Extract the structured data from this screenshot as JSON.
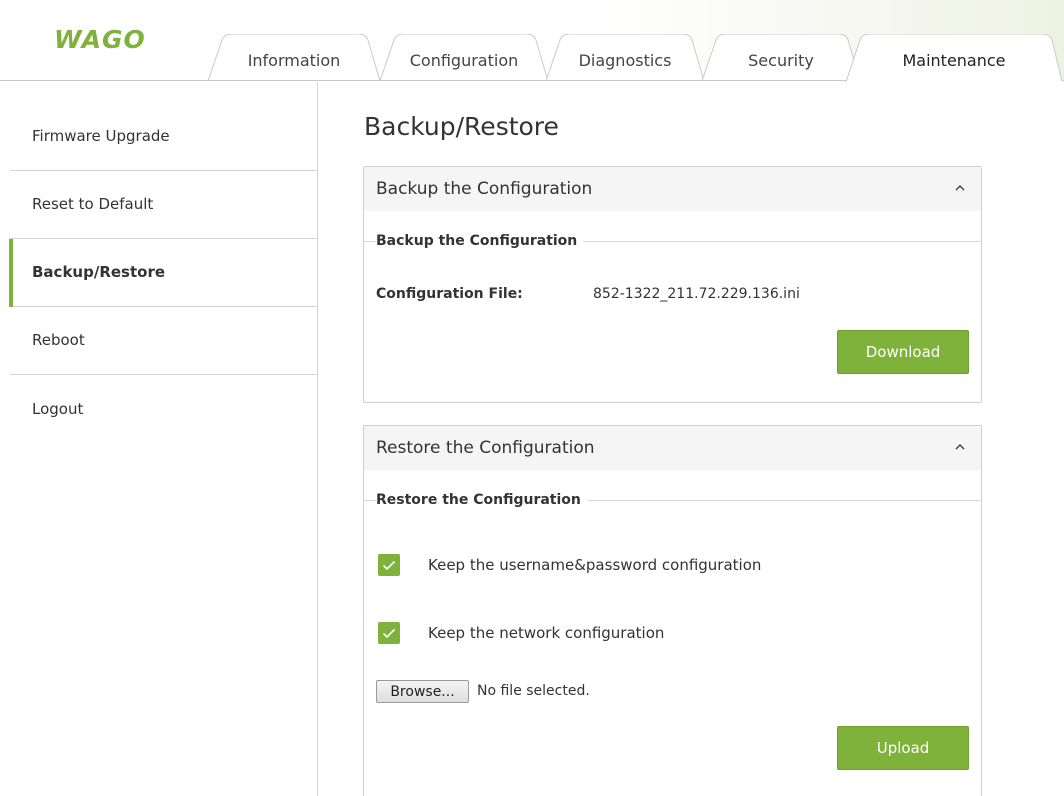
{
  "brand": {
    "logo_text": "WAGO",
    "accent_color": "#7fb23a"
  },
  "tabs": [
    {
      "label": "Information",
      "active": false
    },
    {
      "label": "Configuration",
      "active": false
    },
    {
      "label": "Diagnostics",
      "active": false
    },
    {
      "label": "Security",
      "active": false
    },
    {
      "label": "Maintenance",
      "active": true
    }
  ],
  "sidebar": {
    "items": [
      {
        "label": "Firmware Upgrade",
        "active": false
      },
      {
        "label": "Reset to Default",
        "active": false
      },
      {
        "label": "Backup/Restore",
        "active": true
      },
      {
        "label": "Reboot",
        "active": false
      },
      {
        "label": "Logout",
        "active": false
      }
    ]
  },
  "main": {
    "title": "Backup/Restore",
    "backup": {
      "panel_title": "Backup the Configuration",
      "section_title": "Backup the Configuration",
      "file_label": "Configuration File:",
      "file_value": "852-1322_211.72.229.136.ini",
      "button_label": "Download",
      "collapse_icon": "chevron-up-icon"
    },
    "restore": {
      "panel_title": "Restore the Configuration",
      "section_title": "Restore the Configuration",
      "options": [
        {
          "label": "Keep the username&password configuration",
          "checked": true
        },
        {
          "label": "Keep the network configuration",
          "checked": true
        }
      ],
      "browse_label": "Browse...",
      "file_status": "No file selected.",
      "button_label": "Upload",
      "collapse_icon": "chevron-up-icon"
    }
  }
}
